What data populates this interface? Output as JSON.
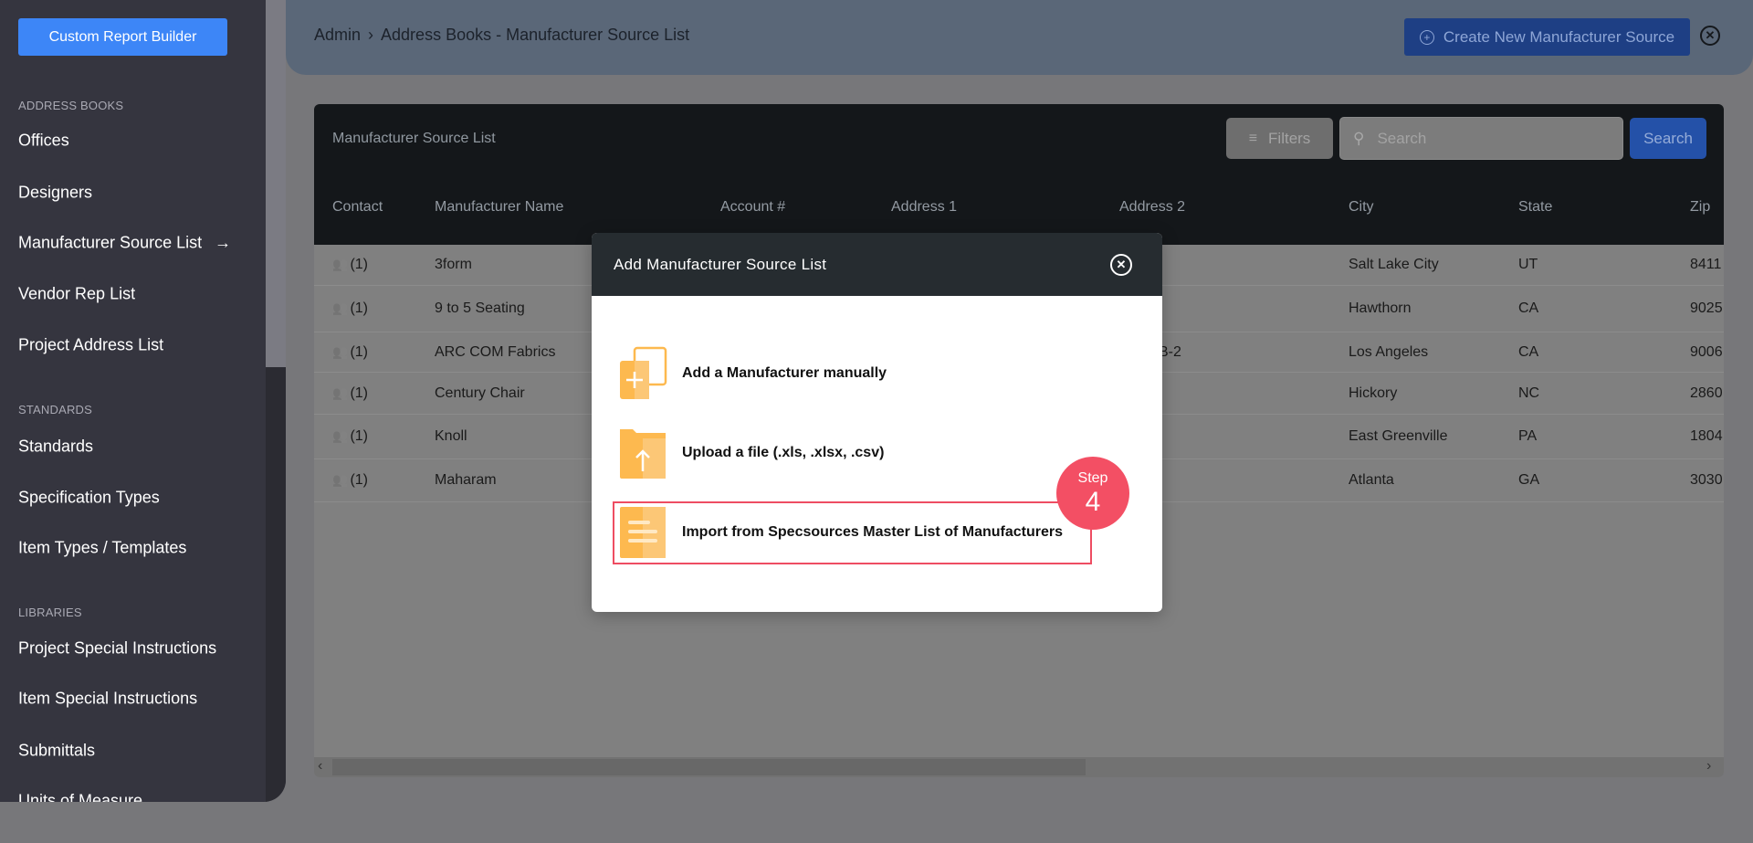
{
  "sidebar": {
    "report_button": "Custom Report Builder",
    "sections": [
      {
        "label": "ADDRESS BOOKS",
        "items": [
          "Offices",
          "Designers",
          "Manufacturer Source List",
          "Vendor Rep List",
          "Project Address List"
        ]
      },
      {
        "label": "STANDARDS",
        "items": [
          "Standards",
          "Specification Types",
          "Item Types / Templates"
        ]
      },
      {
        "label": "LIBRARIES",
        "items": [
          "Project Special Instructions",
          "Item Special Instructions",
          "Submittals",
          "Units of Measure"
        ]
      }
    ],
    "active_item": "Manufacturer Source List"
  },
  "header": {
    "breadcrumb": [
      "Admin",
      "Address Books - Manufacturer Source List"
    ],
    "separator": "›",
    "create_label": "Create New Manufacturer Source"
  },
  "table": {
    "title": "Manufacturer Source List",
    "filters_label": "Filters",
    "search_placeholder": "Search",
    "search_button": "Search",
    "columns": [
      "Contact",
      "Manufacturer Name",
      "Account #",
      "Address 1",
      "Address 2",
      "City",
      "State",
      "Zip"
    ],
    "rows": [
      {
        "contact": "(1)",
        "name": "3form",
        "address2": "",
        "city": "Salt Lake City",
        "state": "UT",
        "zip": "8411"
      },
      {
        "contact": "(1)",
        "name": "9 to 5 Seating",
        "address2": "",
        "city": "Hawthorn",
        "state": "CA",
        "zip": "9025"
      },
      {
        "contact": "(1)",
        "name": "ARC COM Fabrics",
        "address2": "B-2",
        "city": "Los Angeles",
        "state": "CA",
        "zip": "9006"
      },
      {
        "contact": "(1)",
        "name": "Century Chair",
        "address2": "",
        "city": "Hickory",
        "state": "NC",
        "zip": "2860"
      },
      {
        "contact": "(1)",
        "name": "Knoll",
        "address2": "",
        "city": "East Greenville",
        "state": "PA",
        "zip": "1804"
      },
      {
        "contact": "(1)",
        "name": "Maharam",
        "address2": "",
        "city": "Atlanta",
        "state": "GA",
        "zip": "3030"
      }
    ]
  },
  "modal": {
    "title": "Add Manufacturer Source List",
    "options": [
      "Add a Manufacturer manually",
      "Upload a file (.xls, .xlsx, .csv)",
      "Import from Specsources Master List of Manufacturers"
    ],
    "step_label": "Step",
    "step_number": "4"
  },
  "colors": {
    "accent": "#3d86f7",
    "step_badge": "#f34f64",
    "icon_orange": "#fdb94f"
  }
}
